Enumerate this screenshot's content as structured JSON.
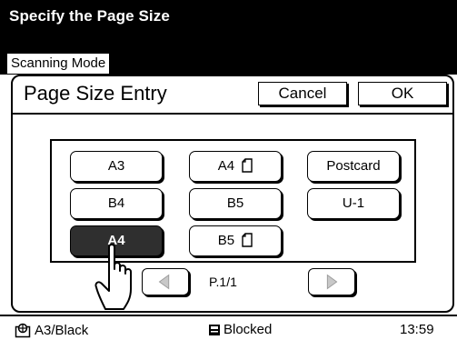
{
  "header": {
    "title": "Specify the Page Size",
    "mode_tab": "Scanning Mode"
  },
  "dialog": {
    "title": "Page Size Entry",
    "cancel_label": "Cancel",
    "ok_label": "OK"
  },
  "sizes": {
    "a3": "A3",
    "a4_portrait": "A4",
    "postcard": "Postcard",
    "b4": "B4",
    "b5": "B5",
    "u1": "U-1",
    "a4_selected": "A4",
    "b5_portrait": "B5"
  },
  "selected_size": "A4",
  "pagination": {
    "indicator": "P.1/1"
  },
  "status": {
    "paper": "A3/Black",
    "lock_state": "Blocked",
    "time": "13:59"
  },
  "icons": {
    "portrait_orientation": "page-portrait-icon",
    "prev": "triangle-left-icon",
    "next": "triangle-right-icon",
    "pointer": "hand-pointer-icon",
    "drum": "drum-icon",
    "block": "block-icon"
  }
}
